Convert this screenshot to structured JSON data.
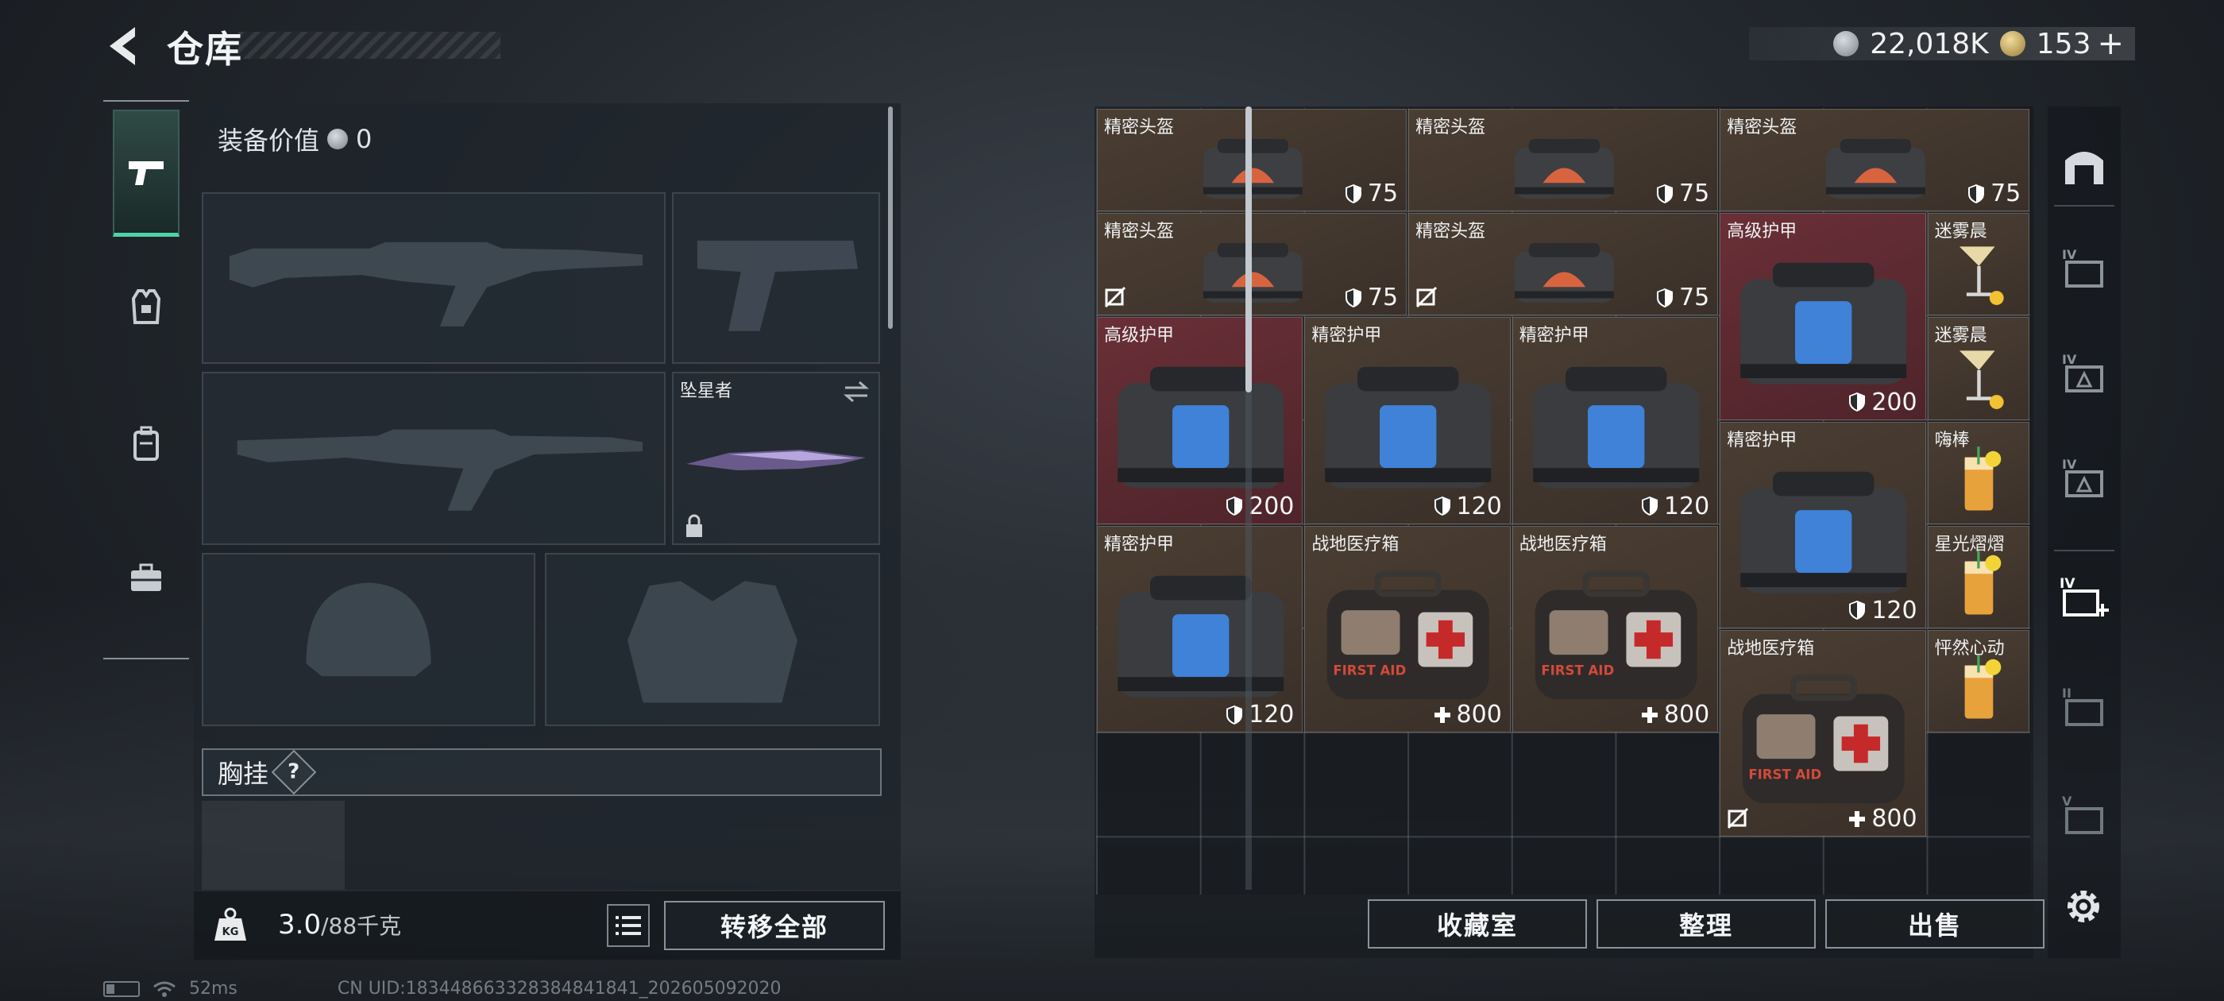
{
  "header": {
    "title": "仓库"
  },
  "currency": {
    "silver": "22,018K",
    "gold": "153",
    "gold_add": "+"
  },
  "loadout": {
    "equip_value_label": "装备价值",
    "equip_value": "0",
    "melee_name": "坠星者",
    "chest_label": "胸挂",
    "help": "?"
  },
  "weight": {
    "current": "3.0",
    "capacity": "/88千克",
    "kg_badge": "KG"
  },
  "buttons": {
    "transfer_all": "转移全部",
    "collection": "收藏室",
    "organize": "整理",
    "sell": "出售"
  },
  "items": [
    {
      "name": "精密头盔",
      "value": "75",
      "kind": "helmet",
      "stat": "shield"
    },
    {
      "name": "精密头盔",
      "value": "75",
      "kind": "helmet",
      "stat": "shield"
    },
    {
      "name": "精密头盔",
      "value": "75",
      "kind": "helmet",
      "stat": "shield"
    },
    {
      "name": "精密头盔",
      "value": "75",
      "kind": "helmet",
      "stat": "shield"
    },
    {
      "name": "精密头盔",
      "value": "75",
      "kind": "helmet",
      "stat": "shield"
    },
    {
      "name": "高级护甲",
      "value": "200",
      "kind": "armor",
      "stat": "shield"
    },
    {
      "name": "迷雾晨",
      "value": "",
      "kind": "cocktail"
    },
    {
      "name": "迷雾晨",
      "value": "",
      "kind": "cocktail"
    },
    {
      "name": "高级护甲",
      "value": "200",
      "kind": "armor",
      "stat": "shield"
    },
    {
      "name": "精密护甲",
      "value": "120",
      "kind": "armor",
      "stat": "shield"
    },
    {
      "name": "精密护甲",
      "value": "120",
      "kind": "armor",
      "stat": "shield"
    },
    {
      "name": "精密护甲",
      "value": "120",
      "kind": "armor",
      "stat": "shield"
    },
    {
      "name": "嗨棒",
      "value": "",
      "kind": "drink"
    },
    {
      "name": "星光熠熠",
      "value": "",
      "kind": "drink"
    },
    {
      "name": "精密护甲",
      "value": "120",
      "kind": "armor",
      "stat": "shield"
    },
    {
      "name": "战地医疗箱",
      "value": "800",
      "kind": "medkit",
      "stat": "plus"
    },
    {
      "name": "战地医疗箱",
      "value": "800",
      "kind": "medkit",
      "stat": "plus"
    },
    {
      "name": "战地医疗箱",
      "value": "800",
      "kind": "medkit",
      "stat": "plus"
    },
    {
      "name": "怦然心动",
      "value": "",
      "kind": "drink"
    }
  ],
  "medkit_art_text": "FIRST AID",
  "tabs": [
    "all",
    "IV",
    "IV",
    "IV",
    "IV+",
    "II",
    "V"
  ],
  "status": {
    "ping": "52ms",
    "uid": "CN UID:183448663328384841841_202605092020"
  },
  "colors": {
    "accent": "#4fd3a6",
    "item_brown": "#4b3e33",
    "item_red": "#6a2f37"
  }
}
